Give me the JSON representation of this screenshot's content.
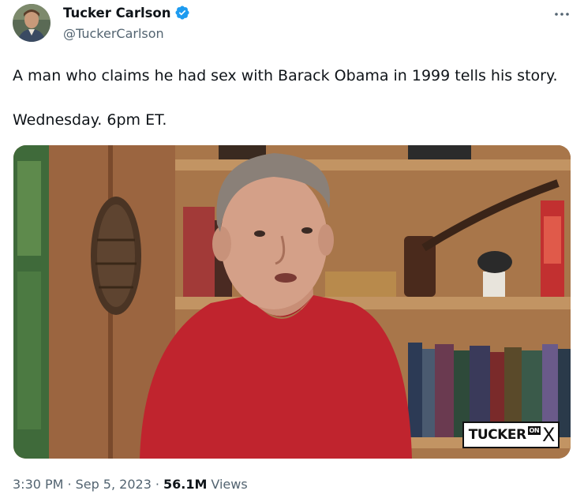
{
  "author": {
    "display_name": "Tucker Carlson",
    "handle": "@TuckerCarlson",
    "verified_icon": "verified-badge-icon"
  },
  "tweet": {
    "text": "A man who claims he had sex with Barack Obama in 1999 tells his story.\n\nWednesday. 6pm ET."
  },
  "media": {
    "watermark_main": "TUCKER",
    "watermark_on": "ON",
    "watermark_x": "X"
  },
  "meta": {
    "time": "3:30 PM",
    "separator": "·",
    "date": "Sep 5, 2023",
    "views_count": "56.1M",
    "views_label": "Views"
  },
  "colors": {
    "text_primary": "#0f1419",
    "text_secondary": "#536471",
    "verified_blue": "#1d9bf0"
  },
  "icons": {
    "more": "more-options-icon"
  }
}
